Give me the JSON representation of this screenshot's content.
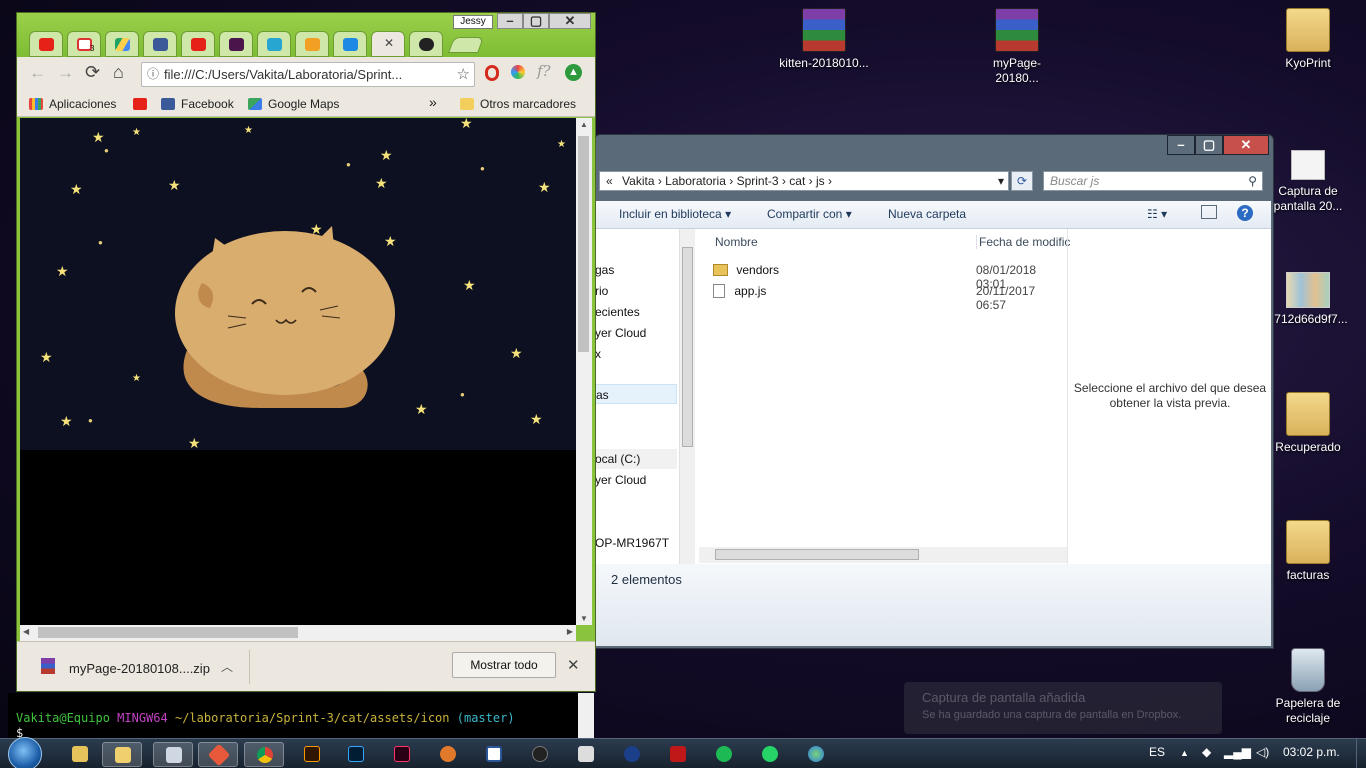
{
  "desktop": {
    "icons": [
      {
        "label": "kitten-2018010..."
      },
      {
        "label": "myPage-20180..."
      },
      {
        "label": "KyoPrint"
      },
      {
        "label": "Captura de pantalla 20..."
      },
      {
        "label": "c712d66d9f7..."
      },
      {
        "label": "Recuperado"
      },
      {
        "label": "facturas"
      },
      {
        "label": "Papelera de reciclaje"
      }
    ]
  },
  "chrome": {
    "profile_name": "Jessy",
    "tab_icons": [
      "youtube-icon",
      "gmail-icon",
      "google-drive-icon",
      "facebook-icon",
      "youtube-icon",
      "slack-icon",
      "play-icon",
      "code-icon",
      "bootstrap-icon",
      "close-icon",
      "github-icon"
    ],
    "gmail_badge": "3",
    "url": "file:///C:/Users/Vakita/Laboratoria/Sprint...",
    "bookmarks": {
      "apps": "Aplicaciones",
      "facebook": "Facebook",
      "maps": "Google Maps",
      "more": "»",
      "other": "Otros marcadores"
    },
    "download": {
      "filename": "myPage-20180108....zip",
      "show_all": "Mostrar todo"
    },
    "colors": {
      "frame": "#8ac33d",
      "sky": "#0d1020",
      "star": "#f6e27a",
      "cat": "#d9ad6e",
      "tail": "#c08a4c"
    }
  },
  "explorer": {
    "breadcrumb": [
      "Vakita",
      "Laboratoria",
      "Sprint-3",
      "cat",
      "js"
    ],
    "breadcrumb_prefix": "«",
    "search_placeholder": "Buscar js",
    "toolbar": {
      "include": "Incluir en biblioteca",
      "share": "Compartir con",
      "new_folder": "Nueva carpeta"
    },
    "nav_items": [
      "gas",
      "rio",
      "ecientes",
      "yer Cloud",
      "x",
      "as",
      "ocal (C:)",
      "yer Cloud",
      "OP-MR1967T"
    ],
    "columns": {
      "name": "Nombre",
      "date": "Fecha de modific"
    },
    "files": [
      {
        "name": "vendors",
        "date": "08/01/2018 03:01",
        "type": "folder"
      },
      {
        "name": "app.js",
        "date": "20/11/2017 06:57",
        "type": "file"
      }
    ],
    "preview_text": "Seleccione el archivo del que desea obtener la vista previa.",
    "status": "2 elementos"
  },
  "terminal": {
    "user": "Vakita@Equipo",
    "shell": "MINGW64",
    "path": "~/laboratoria/Sprint-3/cat/assets/icon",
    "branch": "(master)",
    "prompt": "$"
  },
  "notification": {
    "line1": "Captura de pantalla añadida",
    "line2": "Se ha guardado una captura de pantalla en Dropbox."
  },
  "taskbar": {
    "icons": [
      "start-orb",
      "file-manager-icon",
      "explorer-icon",
      "notepad-icon",
      "git-icon",
      "chrome-icon",
      "illustrator-icon",
      "photoshop-icon",
      "indesign-icon",
      "misc-icon",
      "word-icon",
      "ninja-icon",
      "paint-icon",
      "app-icon",
      "mcafee-icon",
      "spotify-icon",
      "whatsapp-icon",
      "globe-icon"
    ],
    "language": "ES",
    "time": "03:02 p.m."
  }
}
